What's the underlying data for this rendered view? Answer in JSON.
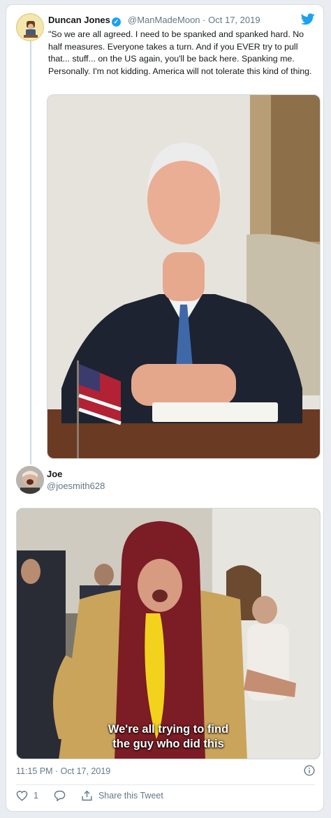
{
  "tweet": {
    "author_name": "Duncan Jones",
    "author_handle": "@ManMadeMoon",
    "separator": "·",
    "date": "Oct 17, 2019",
    "text": "\"So we are all agreed.  I need to be spanked and spanked hard.  No half measures.  Everyone takes a turn.  And if you EVER try to pull that... stuff... on the US again, you'll be back here.  Spanking me.  Personally. I'm not kidding.  America will not tolerate this kind of thing."
  },
  "reply": {
    "author_name": "Joe",
    "author_handle": "@joesmith628",
    "gif_caption_line1": "We're all trying to find",
    "gif_caption_line2": "the guy who did this",
    "timestamp": "11:15 PM · Oct 17, 2019",
    "like_count": "1",
    "share_label": "Share this Tweet"
  },
  "colors": {
    "twitter_blue": "#1da1f2",
    "secondary_text": "#657786"
  },
  "icons": [
    "twitter-bird-icon",
    "verified-badge-icon",
    "heart-icon",
    "reply-bubble-icon",
    "share-icon",
    "info-icon"
  ]
}
